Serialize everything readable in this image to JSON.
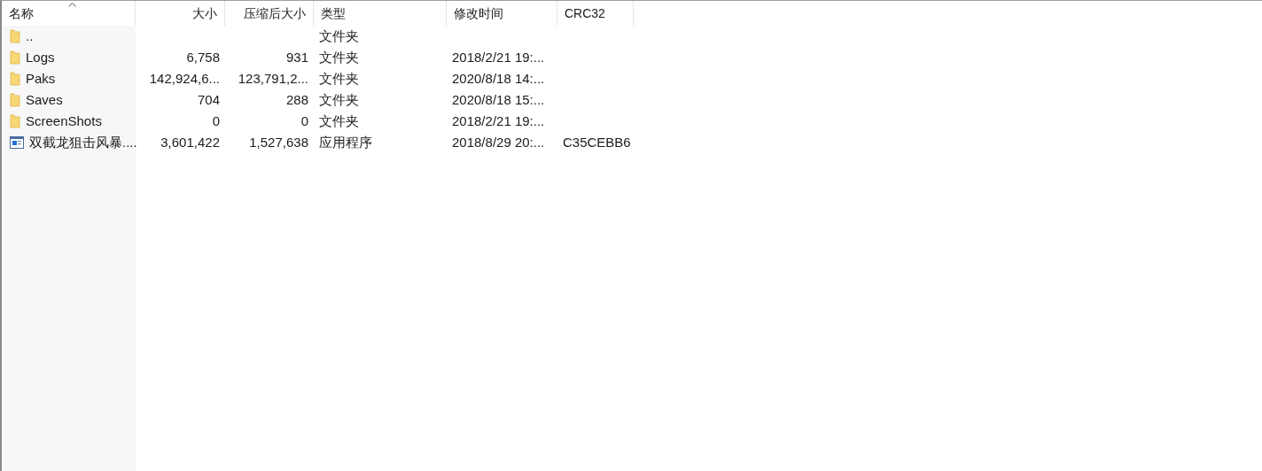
{
  "table": {
    "columns": [
      {
        "label": "名称",
        "sorted": true
      },
      {
        "label": "大小",
        "sorted": false
      },
      {
        "label": "压缩后大小",
        "sorted": false
      },
      {
        "label": "类型",
        "sorted": false
      },
      {
        "label": "修改时间",
        "sorted": false
      },
      {
        "label": "CRC32",
        "sorted": false
      }
    ],
    "rows": [
      {
        "kind": "folder",
        "cells": [
          "..",
          "",
          "",
          "文件夹",
          "",
          ""
        ]
      },
      {
        "kind": "folder",
        "cells": [
          "Logs",
          "6,758",
          "931",
          "文件夹",
          "2018/2/21 19:...",
          ""
        ]
      },
      {
        "kind": "folder",
        "cells": [
          "Paks",
          "142,924,6...",
          "123,791,2...",
          "文件夹",
          "2020/8/18 14:...",
          ""
        ]
      },
      {
        "kind": "folder",
        "cells": [
          "Saves",
          "704",
          "288",
          "文件夹",
          "2020/8/18 15:...",
          ""
        ]
      },
      {
        "kind": "folder",
        "cells": [
          "ScreenShots",
          "0",
          "0",
          "文件夹",
          "2018/2/21 19:...",
          ""
        ]
      },
      {
        "kind": "program",
        "cells": [
          "双截龙狙击风暴....",
          "3,601,422",
          "1,527,638",
          "应用程序",
          "2018/8/29 20:...",
          "C35CEBB6"
        ]
      }
    ]
  }
}
